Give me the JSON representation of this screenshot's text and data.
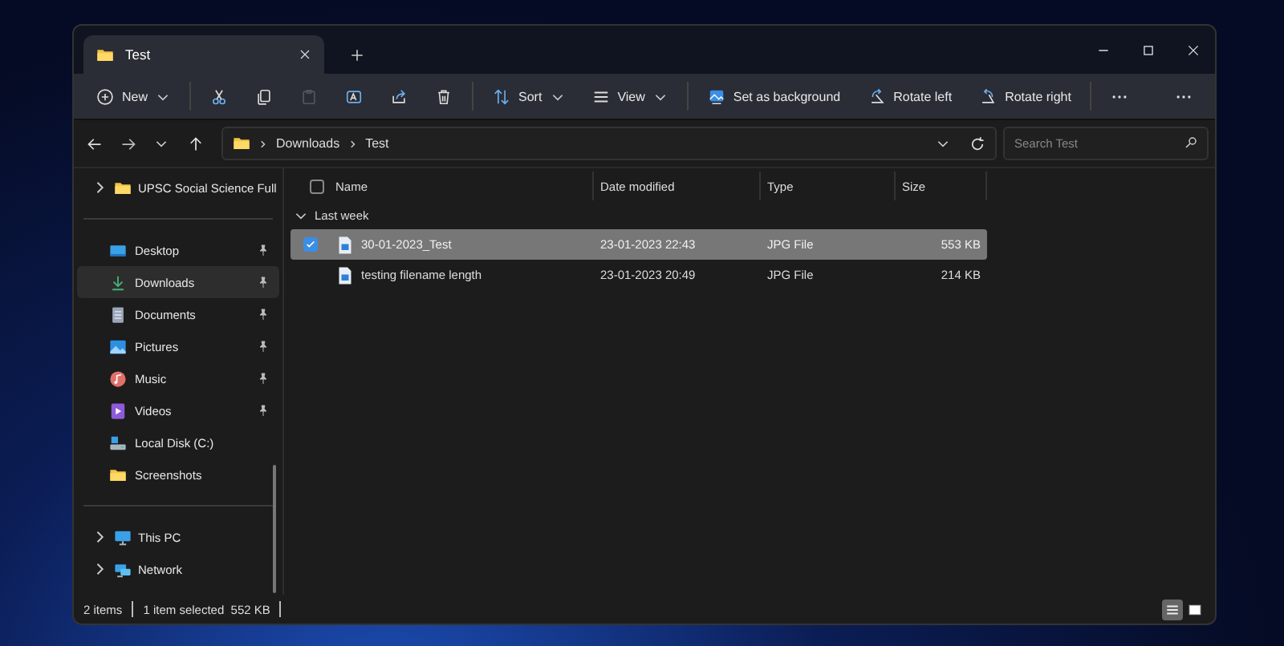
{
  "tabs": [
    {
      "label": "Test",
      "selected": true
    }
  ],
  "toolbar": [
    {
      "kind": "new",
      "label": "New",
      "disabled": false
    },
    {
      "kind": "cut",
      "disabled": false
    },
    {
      "kind": "copy",
      "disabled": false
    },
    {
      "kind": "paste",
      "disabled": true
    },
    {
      "kind": "rename",
      "disabled": false
    },
    {
      "kind": "share",
      "disabled": false
    },
    {
      "kind": "delete",
      "disabled": false
    },
    {
      "kind": "sort",
      "label": "Sort",
      "disabled": false
    },
    {
      "kind": "view",
      "label": "View",
      "disabled": false
    },
    {
      "kind": "background",
      "label": "Set as background",
      "disabled": false
    },
    {
      "kind": "rotate-left",
      "label": "Rotate left",
      "disabled": false
    },
    {
      "kind": "rotate-right",
      "label": "Rotate right",
      "disabled": false
    },
    {
      "kind": "more",
      "disabled": false
    },
    {
      "kind": "more",
      "disabled": false
    }
  ],
  "address": {
    "path": [
      "Downloads",
      "Test"
    ]
  },
  "search": {
    "placeholder": "Search Test"
  },
  "sidebar": {
    "groups": [
      {
        "items": [
          {
            "kind": "folder",
            "label": "UPSC Social Science Full",
            "chevron": true,
            "pinned": false,
            "selected": false
          }
        ]
      },
      {
        "items": [
          {
            "kind": "desktop",
            "label": "Desktop",
            "chevron": false,
            "pinned": true,
            "selected": false
          },
          {
            "kind": "downloads",
            "label": "Downloads",
            "chevron": false,
            "pinned": true,
            "selected": true
          },
          {
            "kind": "documents",
            "label": "Documents",
            "chevron": false,
            "pinned": true,
            "selected": false
          },
          {
            "kind": "pictures",
            "label": "Pictures",
            "chevron": false,
            "pinned": true,
            "selected": false
          },
          {
            "kind": "music",
            "label": "Music",
            "chevron": false,
            "pinned": true,
            "selected": false
          },
          {
            "kind": "videos",
            "label": "Videos",
            "chevron": false,
            "pinned": true,
            "selected": false
          },
          {
            "kind": "drive",
            "label": "Local Disk (C:)",
            "chevron": false,
            "pinned": false,
            "selected": false
          },
          {
            "kind": "folder",
            "label": "Screenshots",
            "chevron": false,
            "pinned": false,
            "selected": false
          }
        ]
      },
      {
        "items": [
          {
            "kind": "pc",
            "label": "This PC",
            "chevron": true,
            "pinned": false,
            "selected": false
          },
          {
            "kind": "network",
            "label": "Network",
            "chevron": true,
            "pinned": false,
            "selected": false
          }
        ]
      }
    ]
  },
  "table": {
    "columns": [
      "Name",
      "Date modified",
      "Type",
      "Size"
    ],
    "select_all": false,
    "groups": [
      {
        "label": "Last week",
        "expanded": true,
        "rows": [
          {
            "name": "30-01-2023_Test",
            "date": "23-01-2023 22:43",
            "type": "JPG File",
            "size": "553 KB",
            "selected": true,
            "checked": true
          },
          {
            "name": "testing filename length",
            "date": "23-01-2023 20:49",
            "type": "JPG File",
            "size": "214 KB",
            "selected": false,
            "checked": false
          }
        ]
      }
    ]
  },
  "status_bar": {
    "items": [
      "2 items",
      "1 item selected  552 KB"
    ]
  },
  "view_buttons": [
    {
      "kind": "details",
      "selected": true
    },
    {
      "kind": "tiles",
      "selected": false
    }
  ]
}
